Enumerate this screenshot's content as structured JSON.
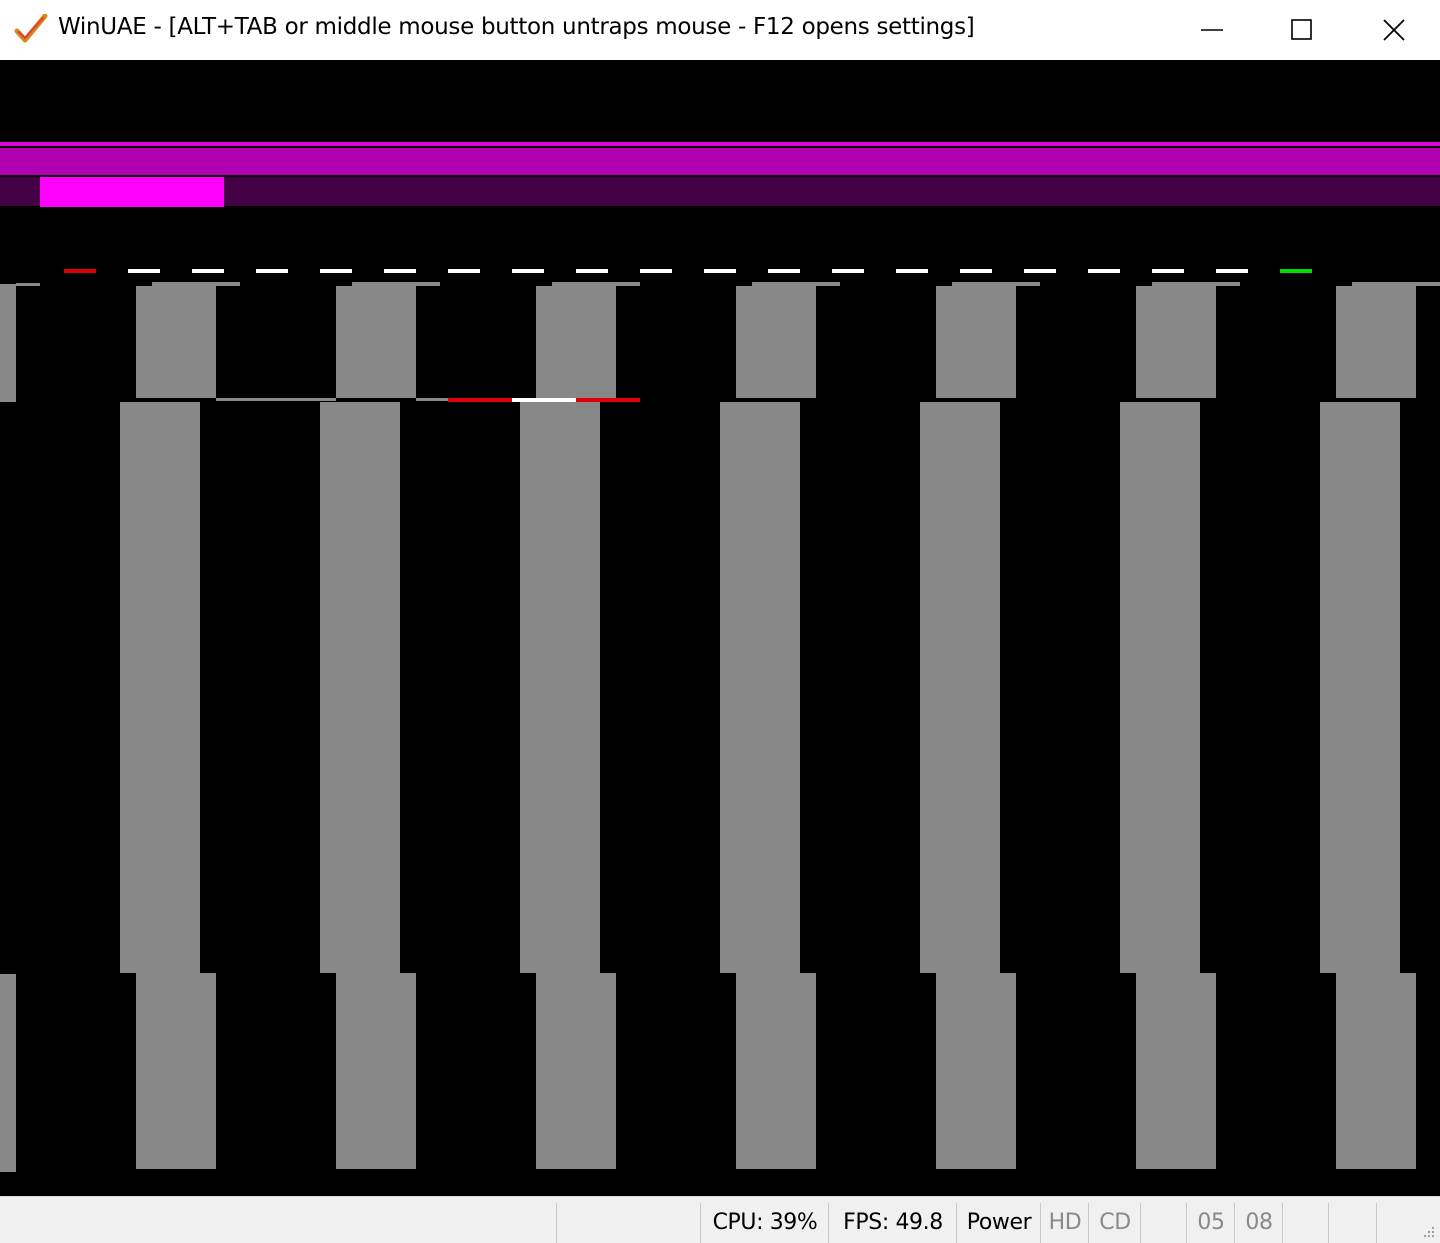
{
  "window": {
    "title": "WinUAE - [ALT+TAB or middle mouse button untraps mouse - F12 opens settings]",
    "controls": [
      "minimize",
      "maximize",
      "close"
    ]
  },
  "screen": {
    "background": "#000000",
    "colors": {
      "pillar": "#888888",
      "magenta_bright": "#ff00ff",
      "magenta": "#b000b0",
      "magenta_dark": "#440044",
      "red": "#dd0000",
      "white": "#ffffff",
      "green": "#00dd00"
    }
  },
  "statusbar": {
    "cpu": "CPU: 39%",
    "fps": "FPS: 49.8",
    "power": "Power",
    "hd": "HD",
    "cd": "CD",
    "drive0": "05",
    "drive1": "08"
  }
}
